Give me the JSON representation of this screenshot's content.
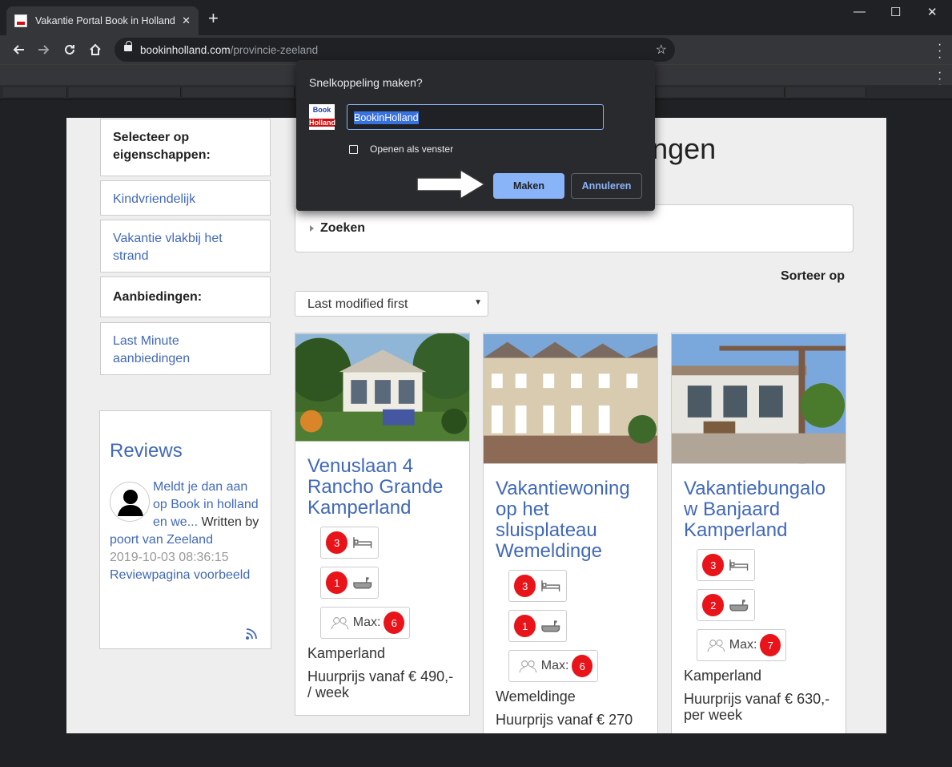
{
  "browser": {
    "tab_title": "Vakantie Portal Book in Holland -",
    "new_tab": "+",
    "url_domain": "bookinholland.com",
    "url_path": "/provincie-zeeland",
    "window_min": "—",
    "window_max": "☐",
    "window_close": "✕"
  },
  "dialog": {
    "title": "Snelkoppeling maken?",
    "favicon_top": "Book",
    "favicon_bottom": "Holland",
    "name_value": "BookinHolland",
    "checkbox_label": "Openen als venster",
    "checkbox_checked": false,
    "confirm_label": "Maken",
    "cancel_label": "Annuleren"
  },
  "sidebar": {
    "filter_heading": "Selecteer op eigenschappen:",
    "filter_items": [
      "Kindvriendelijk",
      "Vakantie vlakbij het strand"
    ],
    "offers_heading": "Aanbiedingen:",
    "offers_items": [
      "Last Minute aanbiedingen"
    ]
  },
  "reviews": {
    "title": "Reviews",
    "link": "Meldt je dan aan op Book in holland en we...",
    "written": "Written by",
    "author": "poort van Zeeland",
    "date": "2019-10-03 08:36:15",
    "page_link": "Reviewpagina voorbeeld"
  },
  "main": {
    "heading": "ntiewoningen",
    "search_label": "Zoeken",
    "sort_label": "Sorteer op",
    "sort_value": "Last modified first"
  },
  "listings": [
    {
      "title": "Venuslaan 4 Rancho Grande Kamperland",
      "bedrooms": "3",
      "bathrooms": "1",
      "max_label": "Max:",
      "max_persons": "6",
      "place": "Kamperland",
      "price": "Huurprijs vanaf € 490,- / week"
    },
    {
      "title": "Vakantiewoning op het sluisplateau Wemeldinge",
      "bedrooms": "3",
      "bathrooms": "1",
      "max_label": "Max:",
      "max_persons": "6",
      "place": "Wemeldinge",
      "price": "Huurprijs vanaf € 270"
    },
    {
      "title": "Vakantiebungalo w Banjaard Kamperland",
      "bedrooms": "3",
      "bathrooms": "2",
      "max_label": "Max:",
      "max_persons": "7",
      "place": "Kamperland",
      "price": "Huurprijs vanaf € 630,- per week"
    }
  ],
  "colors": {
    "accent": "#4169b8",
    "badge": "#e8141a",
    "dialog_button": "#8ab4f8"
  }
}
